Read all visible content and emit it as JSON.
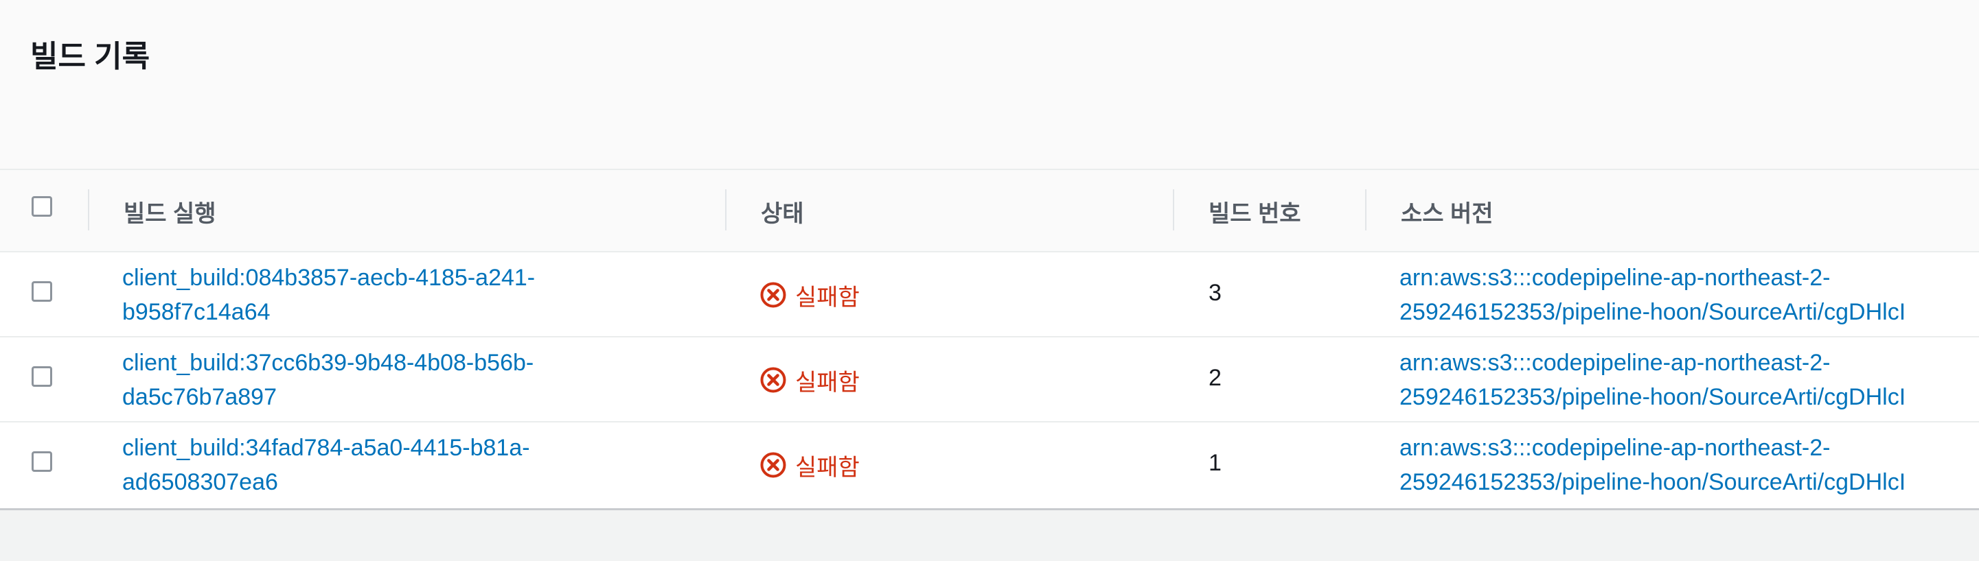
{
  "panel": {
    "title": "빌드 기록"
  },
  "table": {
    "columns": [
      "빌드 실행",
      "상태",
      "빌드 번호",
      "소스 버전"
    ],
    "rows": [
      {
        "run_line1": "client_build:084b3857-aecb-4185-a241-",
        "run_line2": "b958f7c14a64",
        "status": "실패함",
        "build_number": "3",
        "source_line1": "arn:aws:s3:::codepipeline-ap-northeast-2-",
        "source_line2": "259246152353/pipeline-hoon/SourceArti/cgDHlcI"
      },
      {
        "run_line1": "client_build:37cc6b39-9b48-4b08-b56b-",
        "run_line2": "da5c76b7a897",
        "status": "실패함",
        "build_number": "2",
        "source_line1": "arn:aws:s3:::codepipeline-ap-northeast-2-",
        "source_line2": "259246152353/pipeline-hoon/SourceArti/cgDHlcI"
      },
      {
        "run_line1": "client_build:34fad784-a5a0-4415-b81a-",
        "run_line2": "ad6508307ea6",
        "status": "실패함",
        "build_number": "1",
        "source_line1": "arn:aws:s3:::codepipeline-ap-northeast-2-",
        "source_line2": "259246152353/pipeline-hoon/SourceArti/cgDHlcI"
      }
    ]
  },
  "colors": {
    "link": "#0073bb",
    "error": "#d13212",
    "heading": "#16191f",
    "column_header": "#545b64"
  },
  "icons": {
    "status_failed": "close-circle-icon"
  }
}
